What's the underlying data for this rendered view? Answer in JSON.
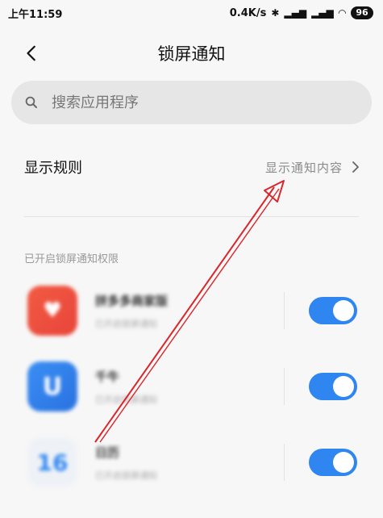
{
  "status_bar": {
    "time": "上午11:59",
    "network_speed": "0.4K/s",
    "battery": "96"
  },
  "header": {
    "title": "锁屏通知"
  },
  "search": {
    "placeholder": "搜索应用程序"
  },
  "rule": {
    "title": "显示规则",
    "value": "显示通知内容"
  },
  "section": {
    "label": "已开启锁屏通知权限"
  },
  "apps": [
    {
      "name": "拼多多商家版",
      "subtitle": "已开启锁屏通知",
      "icon": "app-icon-red",
      "enabled": true
    },
    {
      "name": "千牛",
      "subtitle": "已开启锁屏通知",
      "icon": "app-icon-blue",
      "enabled": true
    },
    {
      "name": "日历",
      "subtitle": "已开启锁屏通知",
      "icon": "calendar-icon",
      "icon_text": "16",
      "enabled": true
    }
  ],
  "colors": {
    "accent": "#2f86f0",
    "annotation_arrow": "#d9262b"
  }
}
